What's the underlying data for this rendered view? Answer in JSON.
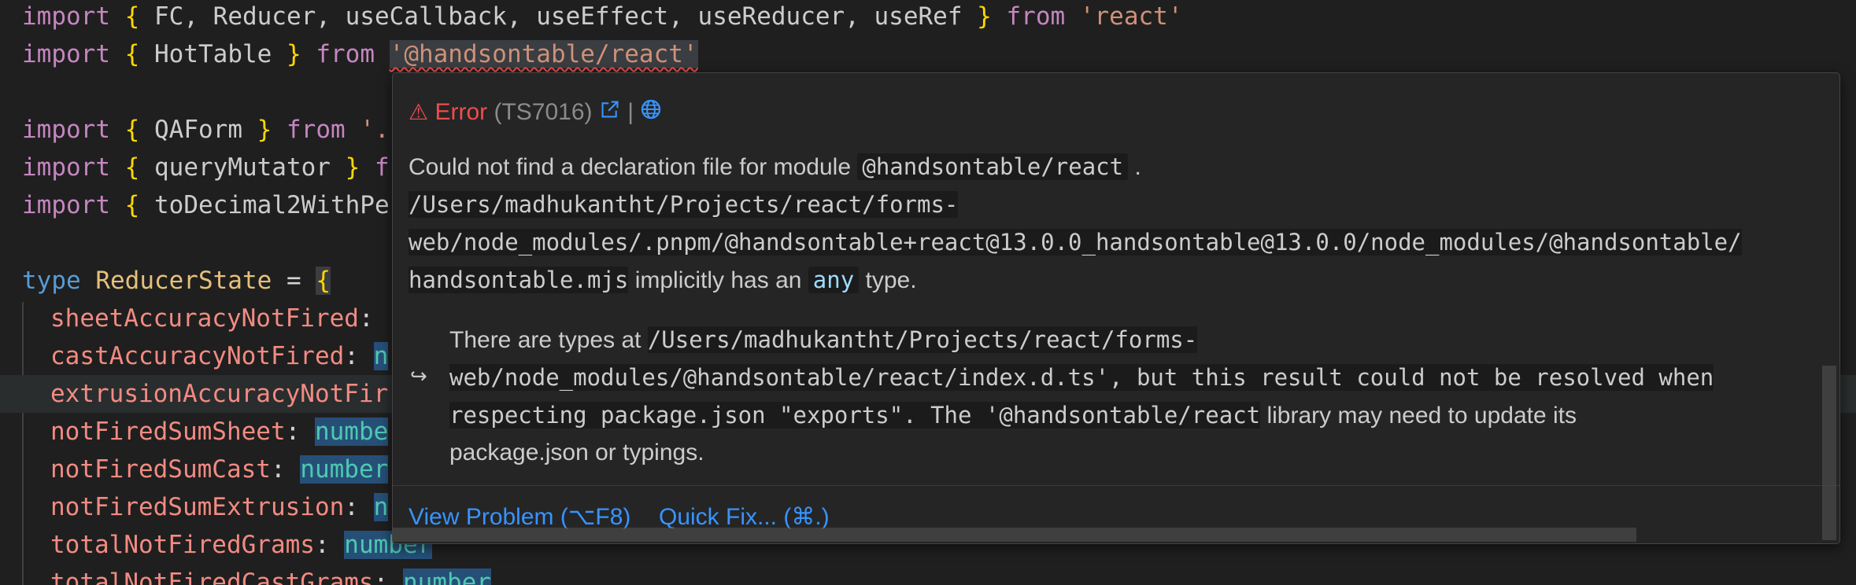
{
  "editor": {
    "lines": [
      {
        "kw": "import",
        "open": "{",
        "ids": "FC, Reducer, useCallback, useEffect, useReducer, useRef",
        "close": "}",
        "from": "from",
        "str": "'react'"
      },
      {
        "kw": "import",
        "open": "{",
        "ids": "HotTable",
        "close": "}",
        "from": "from",
        "str": "'@handsontable/react'"
      },
      {
        "kw": "import",
        "open": "{",
        "ids": "QAForm",
        "close": "}",
        "from": "from",
        "str": "'."
      },
      {
        "kw": "import",
        "open": "{",
        "ids": "queryMutator",
        "close": "}",
        "from": "f"
      },
      {
        "kw": "import",
        "open": "{",
        "ids": "toDecimal2WithPe"
      }
    ],
    "type_line": {
      "kw": "type",
      "name": "ReducerState",
      "eq": "=",
      "open": "{"
    },
    "props": [
      {
        "name": "sheetAccuracyNotFired",
        "colon": ":",
        "type": ""
      },
      {
        "name": "castAccuracyNotFired",
        "colon": ":",
        "type": "n"
      },
      {
        "name": "extrusionAccuracyNotFir",
        "colon": "",
        "type": ""
      },
      {
        "name": "notFiredSumSheet",
        "colon": ":",
        "type": "numbe"
      },
      {
        "name": "notFiredSumCast",
        "colon": ":",
        "type": "number"
      },
      {
        "name": "notFiredSumExtrusion",
        "colon": ":",
        "type": "n"
      },
      {
        "name": "totalNotFiredGrams",
        "colon": ":",
        "type": "number"
      },
      {
        "name": "totalNotFiredCastGrams",
        "colon": ":",
        "type": "number"
      }
    ]
  },
  "hover": {
    "error_icon": "warning-icon",
    "error_label": "Error",
    "error_code": "(TS7016)",
    "pipe": "|",
    "msg1_prefix": "Could not find a declaration file for module",
    "msg1_module": "@handsontable/react",
    "msg1_suffix": ".",
    "path_line1": "/Users/madhukantht/Projects/react/forms-",
    "path_line2": "web/node_modules/.pnpm/@handsontable+react@13.0.0_handsontable@13.0.0/node_modules/@handsontable/",
    "path_line3_file": "handsontable.mjs",
    "path_line3_mid": "implicitly has an",
    "path_line3_any": "any",
    "path_line3_end": "type.",
    "related_arrow": "↪",
    "related1_prefix": "There are types at",
    "related1_path": "/Users/madhukantht/Projects/react/forms-",
    "related2": "web/node_modules/@handsontable/react/index.d.ts', but this result could not be resolved when",
    "related3_code": "respecting package.json \"exports\". The '@handsontable/react",
    "related3_text": "library may need to update its",
    "related4": "package.json or typings.",
    "actions": {
      "view_problem": "View Problem (⌥F8)",
      "quick_fix": "Quick Fix... (⌘.)"
    }
  }
}
